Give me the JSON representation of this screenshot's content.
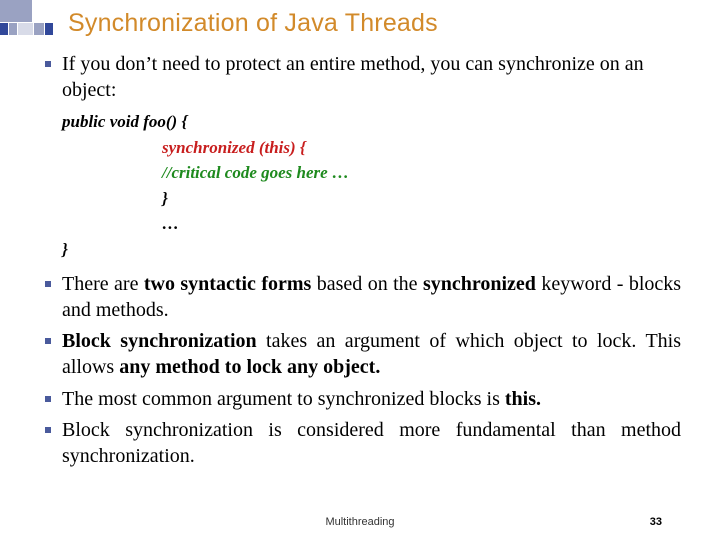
{
  "title": "Synchronization of Java Threads",
  "bullets": {
    "0": "If you don’t need to protect an entire method, you can synchronize on an object:",
    "1": {
      "a": "There are ",
      "b": "two syntactic forms",
      "c": " based on the ",
      "d": "synchronized",
      "e": " keyword - blocks and methods."
    },
    "2": {
      "a": "Block synchronization",
      "b": " takes an argument of which object to lock. This allows ",
      "c": "any method to lock any object."
    },
    "3": {
      "a": "The most common argument to synchronized blocks is ",
      "b": "this."
    },
    "4": "Block synchronization is considered more fundamental than method synchronization."
  },
  "code": {
    "0": "public void foo() {",
    "1": "synchronized (this) {",
    "2": "//critical code goes here …",
    "3": "}",
    "4": "…",
    "5": "}"
  },
  "footer": {
    "topic": "Multithreading",
    "page": "33"
  }
}
